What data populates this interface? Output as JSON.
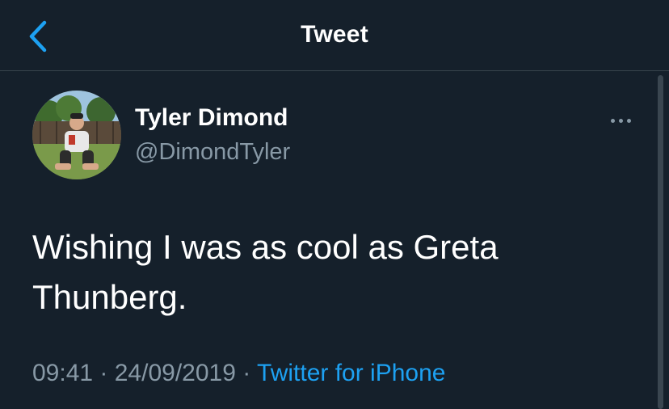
{
  "header": {
    "title": "Tweet",
    "back_icon": "chevron-left-icon"
  },
  "tweet": {
    "author": {
      "name": "Tyler Dimond",
      "handle": "@DimondTyler",
      "avatar_icon": "user-avatar-photo"
    },
    "more_icon": "more-horizontal-icon",
    "text": "Wishing I was as cool as Greta Thunberg.",
    "time": "09:41",
    "separator_1": " · ",
    "date": "24/09/2019",
    "separator_2": " · ",
    "source": "Twitter for iPhone"
  },
  "colors": {
    "background": "#15202b",
    "accent": "#1da1f2",
    "secondary_text": "#8899a6",
    "divider": "#38444d"
  }
}
